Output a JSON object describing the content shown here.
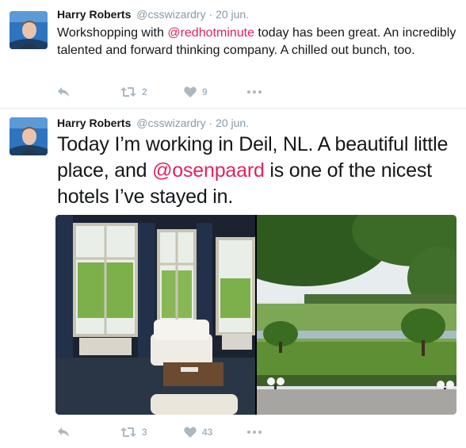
{
  "tweets": [
    {
      "author_name": "Harry Roberts",
      "handle": "@csswizardry",
      "separator": "·",
      "date": "20 jun.",
      "text_before": "Workshopping with ",
      "mention": "@redhotminute",
      "text_after": " today has been great. An incredibly talented and forward thinking company. A chilled out bunch, too.",
      "retweets": "2",
      "likes": "9",
      "icons": [
        "reply-icon",
        "retweet-icon",
        "heart-icon",
        "more-icon"
      ]
    },
    {
      "author_name": "Harry Roberts",
      "handle": "@csswizardry",
      "separator": "·",
      "date": "20 jun.",
      "text_before": "Today I’m working in Deil, NL. A beautiful little place, and ",
      "mention": "@osenpaard",
      "text_after": " is one of the nicest hotels I’ve stayed in.",
      "retweets": "3",
      "likes": "43",
      "icons": [
        "reply-icon",
        "retweet-icon",
        "heart-icon",
        "more-icon"
      ]
    }
  ],
  "colors": {
    "mention": "#e0245e",
    "muted": "#8899a6",
    "action_icon": "#aab8c2",
    "divider": "#e1e8ed"
  }
}
